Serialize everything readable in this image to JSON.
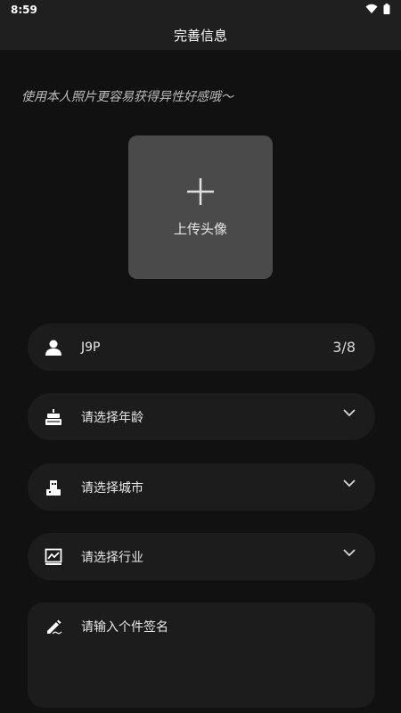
{
  "status": {
    "time": "8:59"
  },
  "header": {
    "title": "完善信息"
  },
  "hint": "使用本人照片更容易获得异性好感哦～",
  "upload": {
    "label": "上传头像"
  },
  "fields": {
    "nickname": {
      "value": "J9P",
      "count": "3/8"
    },
    "age": {
      "placeholder": "请选择年龄"
    },
    "city": {
      "placeholder": "请选择城市"
    },
    "industry": {
      "placeholder": "请选择行业"
    },
    "signature": {
      "placeholder": "请输入个件签名"
    }
  },
  "icons": {
    "status": [
      "wifi-icon",
      "battery-icon"
    ],
    "upload": "plus-icon",
    "nickname": "person-icon",
    "age": "cake-icon",
    "city": "building-icon",
    "industry": "chart-icon",
    "signature": "pen-icon",
    "dropdown": "chevron-down-icon"
  },
  "colors": {
    "background": "#111111",
    "card": "#1c1c1c",
    "upload_box": "#4a4a4a"
  }
}
